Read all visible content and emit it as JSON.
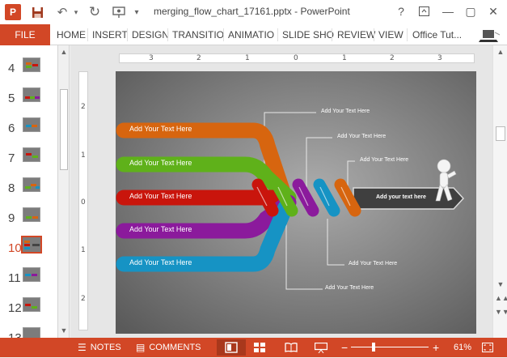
{
  "window": {
    "title": "merging_flow_chart_17161.pptx - PowerPoint",
    "app_icon": "P",
    "help": "?",
    "minimize": "—",
    "restore": "▢",
    "close": "✕"
  },
  "quick_access": {
    "save_icon": "save-icon",
    "undo_icon": "undo-icon",
    "redo_icon": "redo-icon",
    "start_icon": "start-from-beginning-icon",
    "customize": "▾"
  },
  "ribbon": {
    "file": "FILE",
    "tabs": [
      "HOME",
      "INSERT",
      "DESIGN",
      "TRANSITIO",
      "ANIMATIO",
      "SLIDE SHO",
      "REVIEW",
      "VIEW"
    ],
    "account": "Office Tut..."
  },
  "thumbnails": {
    "numbers": [
      "4",
      "5",
      "6",
      "7",
      "8",
      "9",
      "10",
      "11",
      "12",
      "13"
    ],
    "active": "10"
  },
  "ruler": {
    "horizontal": [
      "3",
      "2",
      "1",
      "0",
      "1",
      "2",
      "3"
    ],
    "vertical": [
      "2",
      "1",
      "0",
      "1",
      "2"
    ]
  },
  "slide": {
    "left_boxes": [
      "Add Your Text Here",
      "Add Your Text Here",
      "Add Your Text Here",
      "Add Your Text Here",
      "Add Your Text Here"
    ],
    "callouts": [
      "Add Your Text Here",
      "Add Your Text Here",
      "Add Your Text Here",
      "Add Your Text Here",
      "Add Your Text Here"
    ],
    "arrow_text": "Add your text here",
    "colors": {
      "orange": "#d7650f",
      "green": "#5fb11a",
      "red": "#c9150c",
      "purple": "#8b1a9c",
      "blue": "#1693c4",
      "background": "#6e6e6e"
    }
  },
  "status_bar": {
    "notes": "NOTES",
    "comments": "COMMENTS",
    "zoom": "61%",
    "zoom_level": 0.61
  }
}
